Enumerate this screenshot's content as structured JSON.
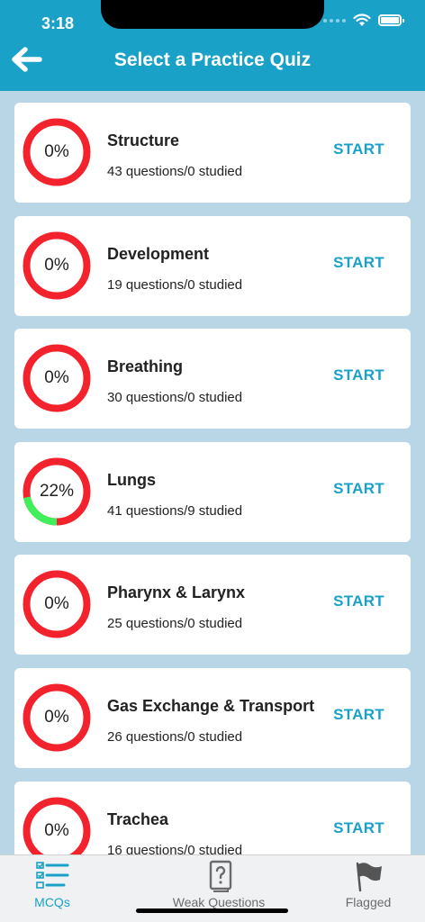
{
  "status_bar": {
    "time": "3:18"
  },
  "header": {
    "title": "Select a Practice Quiz",
    "back_icon": "arrow-left-icon"
  },
  "colors": {
    "accent": "#1aa1c8",
    "ring_incomplete": "#f2232d",
    "ring_complete": "#3ff05a",
    "background": "#b9d6e6"
  },
  "quizzes": [
    {
      "title": "Structure",
      "subtitle": "43 questions/0 studied",
      "percent_label": "0%",
      "progress": 0,
      "action": "START"
    },
    {
      "title": "Development",
      "subtitle": "19 questions/0 studied",
      "percent_label": "0%",
      "progress": 0,
      "action": "START"
    },
    {
      "title": "Breathing",
      "subtitle": "30 questions/0 studied",
      "percent_label": "0%",
      "progress": 0,
      "action": "START"
    },
    {
      "title": "Lungs",
      "subtitle": "41 questions/9 studied",
      "percent_label": "22%",
      "progress": 0.22,
      "action": "START"
    },
    {
      "title": "Pharynx & Larynx",
      "subtitle": "25 questions/0 studied",
      "percent_label": "0%",
      "progress": 0,
      "action": "START"
    },
    {
      "title": "Gas Exchange & Transport",
      "subtitle": "26 questions/0 studied",
      "percent_label": "0%",
      "progress": 0,
      "action": "START"
    },
    {
      "title": "Trachea",
      "subtitle": "16 questions/0 studied",
      "percent_label": "0%",
      "progress": 0,
      "action": "START"
    }
  ],
  "tabbar": {
    "tabs": [
      {
        "label": "MCQs",
        "icon": "checklist-icon",
        "active": true
      },
      {
        "label": "Weak Questions",
        "icon": "question-book-icon",
        "active": false
      },
      {
        "label": "Flagged",
        "icon": "flag-icon",
        "active": false
      }
    ]
  }
}
